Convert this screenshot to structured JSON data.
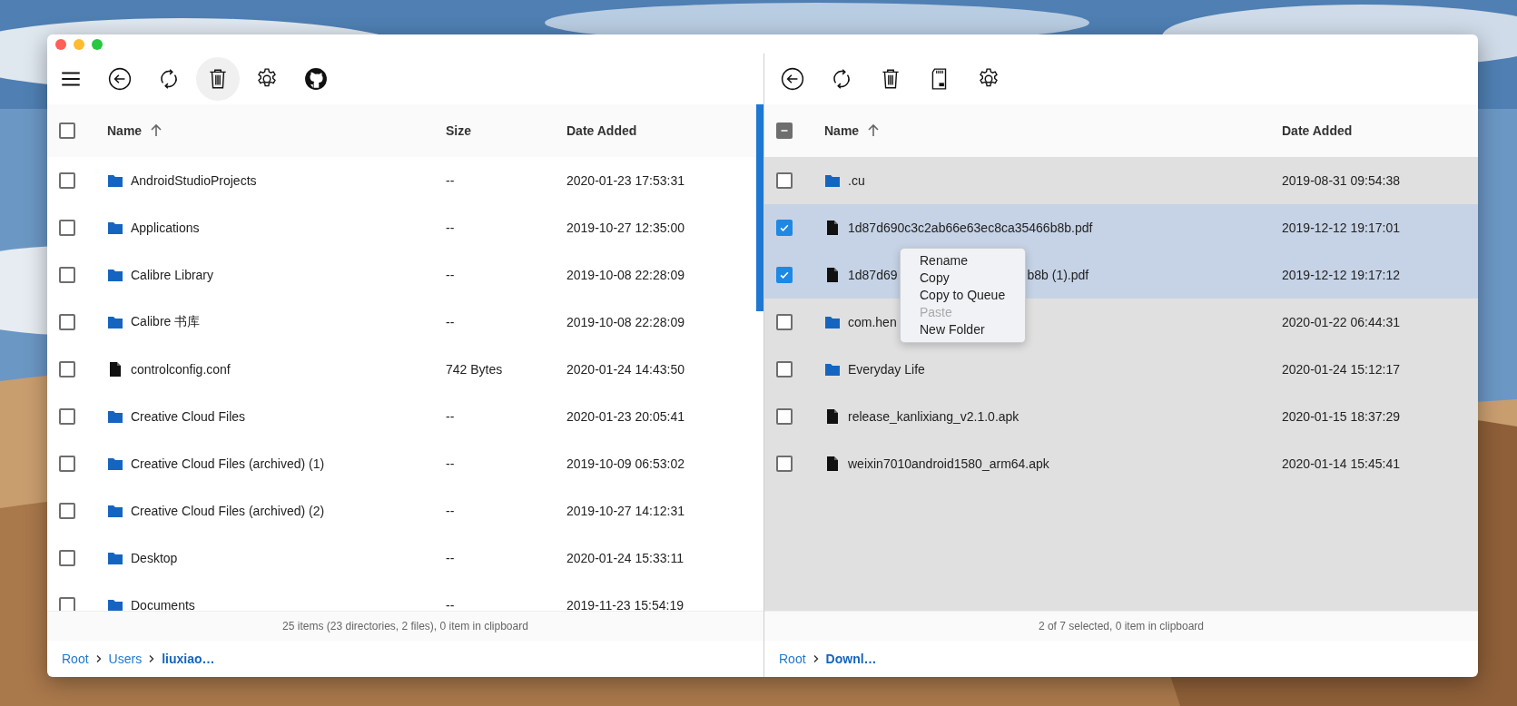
{
  "panes": [
    {
      "toolbar": [
        {
          "kind": "menu",
          "highlighted": false
        },
        {
          "kind": "back",
          "highlighted": false
        },
        {
          "kind": "refresh",
          "highlighted": false
        },
        {
          "kind": "trash",
          "highlighted": true
        },
        {
          "kind": "settings",
          "highlighted": false
        },
        {
          "kind": "github",
          "highlighted": false
        }
      ],
      "header_checkbox": {
        "checked": false,
        "partial": false
      },
      "columns": [
        {
          "kind": "name",
          "label": "Name",
          "sorted": true
        },
        {
          "kind": "size",
          "label": "Size",
          "sorted": false
        },
        {
          "kind": "date",
          "label": "Date Added",
          "sorted": false
        }
      ],
      "rows": [
        {
          "kind": "folder",
          "name": "AndroidStudioProjects",
          "size": "--",
          "date": "2020-01-23 17:53:31",
          "checked": false
        },
        {
          "kind": "folder",
          "name": "Applications",
          "size": "--",
          "date": "2019-10-27 12:35:00",
          "checked": false
        },
        {
          "kind": "folder",
          "name": "Calibre Library",
          "size": "--",
          "date": "2019-10-08 22:28:09",
          "checked": false
        },
        {
          "kind": "folder",
          "name": "Calibre 书库",
          "size": "--",
          "date": "2019-10-08 22:28:09",
          "checked": false
        },
        {
          "kind": "file",
          "name": "controlconfig.conf",
          "size": "742 Bytes",
          "date": "2020-01-24 14:43:50",
          "checked": false
        },
        {
          "kind": "folder",
          "name": "Creative Cloud Files",
          "size": "--",
          "date": "2020-01-23 20:05:41",
          "checked": false
        },
        {
          "kind": "folder",
          "name": "Creative Cloud Files (archived) (1)",
          "size": "--",
          "date": "2019-10-09 06:53:02",
          "checked": false
        },
        {
          "kind": "folder",
          "name": "Creative Cloud Files (archived) (2)",
          "size": "--",
          "date": "2019-10-27 14:12:31",
          "checked": false
        },
        {
          "kind": "folder",
          "name": "Desktop",
          "size": "--",
          "date": "2020-01-24 15:33:11",
          "checked": false
        },
        {
          "kind": "folder",
          "name": "Documents",
          "size": "--",
          "date": "2019-11-23 15:54:19",
          "checked": false
        }
      ],
      "status": "25 items (23 directories, 2 files), 0 item in clipboard",
      "breadcrumb": [
        {
          "label": "Root",
          "current": false
        },
        {
          "label": "Users",
          "current": false
        },
        {
          "label": "liuxiao…",
          "current": true
        }
      ]
    },
    {
      "toolbar": [
        {
          "kind": "back",
          "highlighted": false
        },
        {
          "kind": "refresh",
          "highlighted": false
        },
        {
          "kind": "trash",
          "highlighted": false
        },
        {
          "kind": "sdcard",
          "highlighted": false
        },
        {
          "kind": "settings",
          "highlighted": false
        }
      ],
      "header_checkbox": {
        "checked": false,
        "partial": true
      },
      "columns": [
        {
          "kind": "name",
          "label": "Name",
          "sorted": true
        },
        {
          "kind": "date",
          "label": "Date Added",
          "sorted": false
        }
      ],
      "rows": [
        {
          "kind": "folder",
          "name": ".cu",
          "date": "2019-08-31 09:54:38",
          "checked": false
        },
        {
          "kind": "file",
          "name": "1d87d690c3c2ab66e63ec8ca35466b8b.pdf",
          "date": "2019-12-12 19:17:01",
          "checked": true
        },
        {
          "kind": "file",
          "name": "1d87d69",
          "name_tail": "b8b (1).pdf",
          "date": "2019-12-12 19:17:12",
          "checked": true
        },
        {
          "kind": "folder",
          "name": "com.hen",
          "date": "2020-01-22 06:44:31",
          "checked": false
        },
        {
          "kind": "folder",
          "name": "Everyday Life",
          "date": "2020-01-24 15:12:17",
          "checked": false
        },
        {
          "kind": "file",
          "name": "release_kanlixiang_v2.1.0.apk",
          "date": "2020-01-15 18:37:29",
          "checked": false
        },
        {
          "kind": "file",
          "name": "weixin7010android1580_arm64.apk",
          "date": "2020-01-14 15:45:41",
          "checked": false
        }
      ],
      "status": "2 of 7 selected, 0 item in clipboard",
      "breadcrumb": [
        {
          "label": "Root",
          "current": false
        },
        {
          "label": "Downl…",
          "current": true
        }
      ],
      "context_menu": [
        {
          "label": "Rename",
          "disabled": false
        },
        {
          "label": "Copy",
          "disabled": false
        },
        {
          "label": "Copy to Queue",
          "disabled": false
        },
        {
          "label": "Paste",
          "disabled": true
        },
        {
          "label": "New Folder",
          "disabled": false
        }
      ]
    }
  ]
}
